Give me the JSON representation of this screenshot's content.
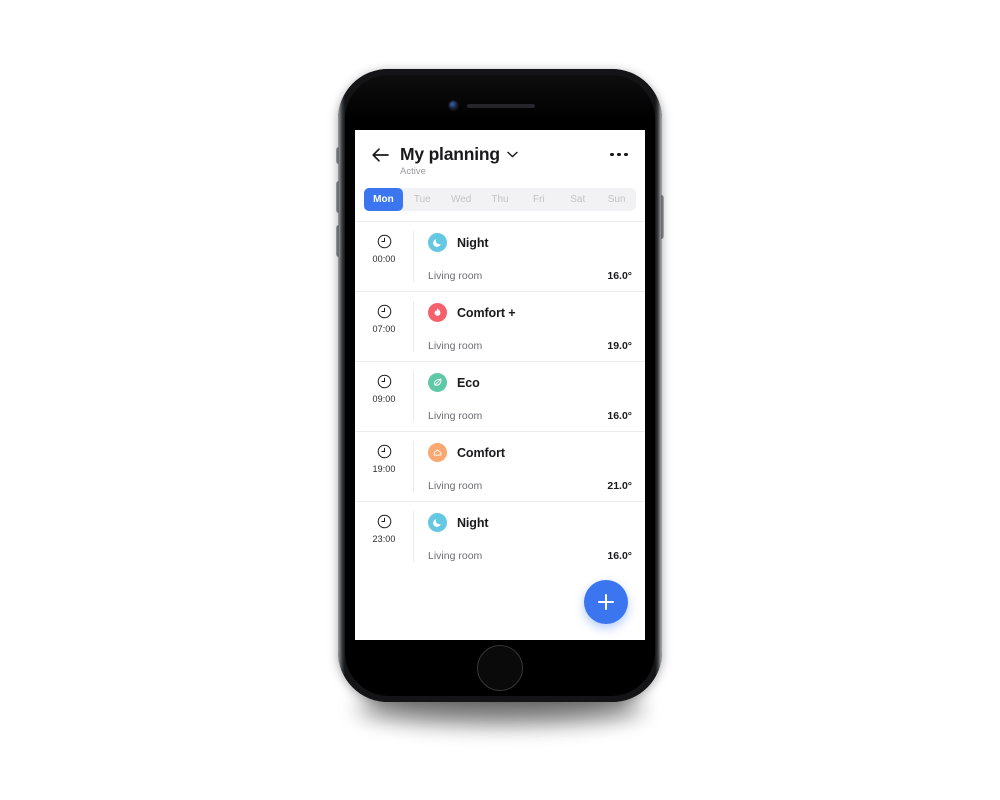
{
  "app": {
    "title": "My planning",
    "subtitle": "Active",
    "back_icon": "back-arrow-icon",
    "title_chevron_icon": "chevron-down-icon",
    "overflow_icon": "more-options-icon",
    "accent_color": "#3b76f0"
  },
  "days": {
    "items": [
      {
        "label": "Mon",
        "active": true
      },
      {
        "label": "Tue",
        "active": false
      },
      {
        "label": "Wed",
        "active": false
      },
      {
        "label": "Thu",
        "active": false
      },
      {
        "label": "Fri",
        "active": false
      },
      {
        "label": "Sat",
        "active": false
      },
      {
        "label": "Sun",
        "active": false
      }
    ]
  },
  "schedule": {
    "rows": [
      {
        "time": "00:00",
        "clock_icon": "clock-icon",
        "mode": "Night",
        "mode_icon": "moon-icon",
        "mode_color": "#64c8e2",
        "room": "Living room",
        "temperature": "16.0°"
      },
      {
        "time": "07:00",
        "clock_icon": "clock-icon",
        "mode": "Comfort +",
        "mode_icon": "flame-icon",
        "mode_color": "#f4606c",
        "room": "Living room",
        "temperature": "19.0°"
      },
      {
        "time": "09:00",
        "clock_icon": "clock-icon",
        "mode": "Eco",
        "mode_icon": "leaf-icon",
        "mode_color": "#5fc8a8",
        "room": "Living room",
        "temperature": "16.0°"
      },
      {
        "time": "19:00",
        "clock_icon": "clock-icon",
        "mode": "Comfort",
        "mode_icon": "house-icon",
        "mode_color": "#f9a871",
        "room": "Living room",
        "temperature": "21.0°"
      },
      {
        "time": "23:00",
        "clock_icon": "clock-icon",
        "mode": "Night",
        "mode_icon": "moon-icon",
        "mode_color": "#64c8e2",
        "room": "Living room",
        "temperature": "16.0°"
      }
    ]
  },
  "fab": {
    "icon": "plus-icon",
    "color": "#3b76f0"
  }
}
